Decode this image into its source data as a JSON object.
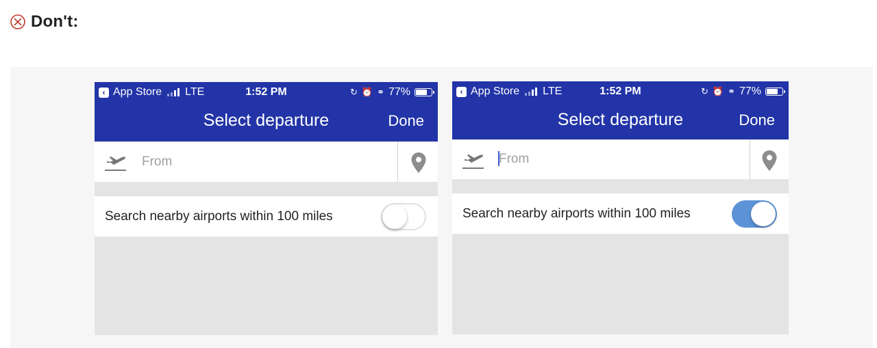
{
  "heading": {
    "icon": "x-circle-icon",
    "title": "Don't:"
  },
  "colors": {
    "nav_bar": "#2234a7",
    "toggle_on": "#5b93d6",
    "heading_icon": "#c0392b"
  },
  "phones": [
    {
      "status": {
        "back_label": "App Store",
        "network": "LTE",
        "time": "1:52 PM",
        "battery": "77%"
      },
      "nav": {
        "title": "Select departure",
        "done_label": "Done"
      },
      "from": {
        "placeholder": "From"
      },
      "toggle": {
        "label": "Search nearby airports within 100 miles",
        "state": "off"
      }
    },
    {
      "status": {
        "back_label": "App Store",
        "network": "LTE",
        "time": "1:52 PM",
        "battery": "77%"
      },
      "nav": {
        "title": "Select departure",
        "done_label": "Done"
      },
      "from": {
        "placeholder": "From"
      },
      "toggle": {
        "label": "Search nearby airports within 100 miles",
        "state": "on"
      }
    }
  ]
}
